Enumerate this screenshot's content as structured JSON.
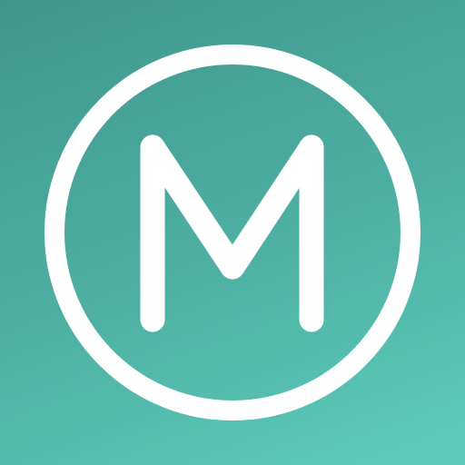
{
  "app_icon": {
    "logo_letter": "M",
    "icon": "circled-m-logo",
    "colors": {
      "background_top": "#3f978c",
      "background_bottom": "#5ccdbd",
      "foreground": "#ffffff"
    }
  }
}
